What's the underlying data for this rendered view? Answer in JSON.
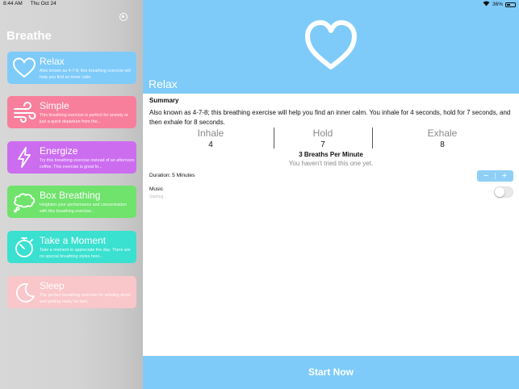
{
  "status_bar": {
    "time": "8:44 AM",
    "date": "Thu Oct 24",
    "battery": "36%"
  },
  "sidebar": {
    "title": "Breathe",
    "cards": [
      {
        "title": "Relax",
        "desc": "Also known as 4-7-8; this breathing exercise will help you find an inner calm.",
        "color": "#7ecbfa",
        "icon": "heart-icon"
      },
      {
        "title": "Simple",
        "desc": "This breathing exercise is perfect for anxiety or just a quick departure from the...",
        "color": "#f87f9c",
        "icon": "wind-icon"
      },
      {
        "title": "Energize",
        "desc": "Try this breathing exercise instead of an afternoon coffee. This exercise is great fo...",
        "color": "#cc6df0",
        "icon": "lightning-icon"
      },
      {
        "title": "Box Breathing",
        "desc": "Heighten your performance and concentration with this breathing exercise...",
        "color": "#6fe36b",
        "icon": "thought-bubble-icon"
      },
      {
        "title": "Take a Moment",
        "desc": "Take a moment to appreciate the day. There are no special breathing styles here...",
        "color": "#3ae0d0",
        "icon": "stopwatch-icon"
      },
      {
        "title": "Sleep",
        "desc": "The perfect breathing exercise for winding down and getting ready for bed.",
        "color": "#f9c6c9",
        "icon": "moon-icon"
      }
    ]
  },
  "detail": {
    "title": "Relax",
    "hero_color": "#7ecbfa",
    "summary_heading": "Summary",
    "summary_text": "Also known as 4-7-8; this breathing exercise will help you find an inner calm. You inhale for 4 seconds, hold for 7 seconds, and then exhale for 8 seconds.",
    "phases": [
      {
        "label": "Inhale",
        "value": "4"
      },
      {
        "label": "Hold",
        "value": "7"
      },
      {
        "label": "Exhale",
        "value": "8"
      }
    ],
    "breaths_per_minute": "3 Breaths Per Minute",
    "tried_note": "You haven't tried this one yet.",
    "duration": "Duration: 5 Minutes",
    "stepper": {
      "minus": "−",
      "plus": "+"
    },
    "music_label": "Music",
    "music_status": "Starting...",
    "music_on": false
  },
  "start_button": "Start Now"
}
